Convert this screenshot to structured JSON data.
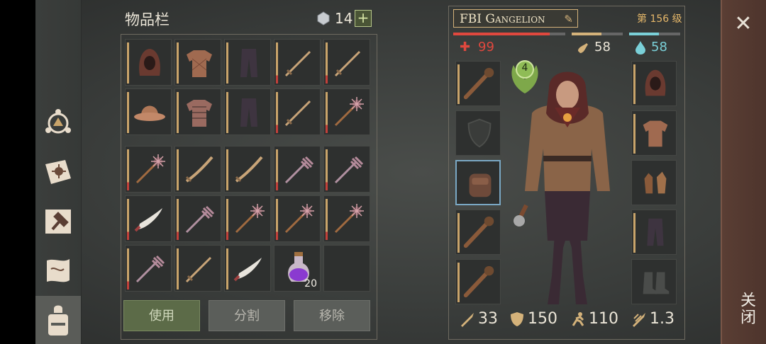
{
  "inventory": {
    "title": "物品栏",
    "gem_count": "14",
    "add_label": "+",
    "grid_top": [
      {
        "name": "hood",
        "bar": "gold"
      },
      {
        "name": "quilted-shirt",
        "bar": "gold"
      },
      {
        "name": "leather-pants",
        "bar": "gold"
      },
      {
        "name": "sword",
        "bar": "red"
      },
      {
        "name": "sword",
        "bar": "red"
      },
      {
        "name": "kettle-helmet",
        "bar": "gold"
      },
      {
        "name": "chainmail-shirt",
        "bar": "gold"
      },
      {
        "name": "leather-pants",
        "bar": "gold"
      },
      {
        "name": "sword",
        "bar": "red"
      },
      {
        "name": "spiked-mace",
        "bar": "red"
      }
    ],
    "grid_bottom": [
      {
        "name": "spiked-mace",
        "bar": "red"
      },
      {
        "name": "saber",
        "bar": "gold"
      },
      {
        "name": "saber",
        "bar": "gold"
      },
      {
        "name": "flanged-mace",
        "bar": "red"
      },
      {
        "name": "flanged-mace",
        "bar": "red"
      },
      {
        "name": "scimitar",
        "bar": "red"
      },
      {
        "name": "flanged-mace",
        "bar": "red"
      },
      {
        "name": "spiked-mace",
        "bar": "red"
      },
      {
        "name": "spiked-mace",
        "bar": "red"
      },
      {
        "name": "spiked-mace",
        "bar": "red"
      },
      {
        "name": "flanged-mace",
        "bar": "red"
      },
      {
        "name": "sword",
        "bar": "gold"
      },
      {
        "name": "scimitar",
        "bar": "gold"
      },
      {
        "name": "potion",
        "bar": "none",
        "qty": "20"
      },
      {
        "name": "empty",
        "bar": "none"
      }
    ],
    "actions": {
      "use": "使用",
      "split": "分割",
      "remove": "移除"
    }
  },
  "character": {
    "name": "FBI Gangelion",
    "level": "第 156 级",
    "health": "99",
    "food": "58",
    "water": "58",
    "badge_level": "4",
    "stats": {
      "attack": "33",
      "defense": "150",
      "speed": "110",
      "attack_speed": "1.3"
    },
    "bars": {
      "health": 0.86,
      "food": 0.58,
      "water": 0.58
    }
  },
  "close": {
    "label": "关闭",
    "icon": "close-icon"
  },
  "colors": {
    "gold": "#c9a46a",
    "red": "#c2403a",
    "health": "#e0483e",
    "food": "#d4b27a",
    "water": "#7ad0d8",
    "use_green": "#5c6b48"
  }
}
